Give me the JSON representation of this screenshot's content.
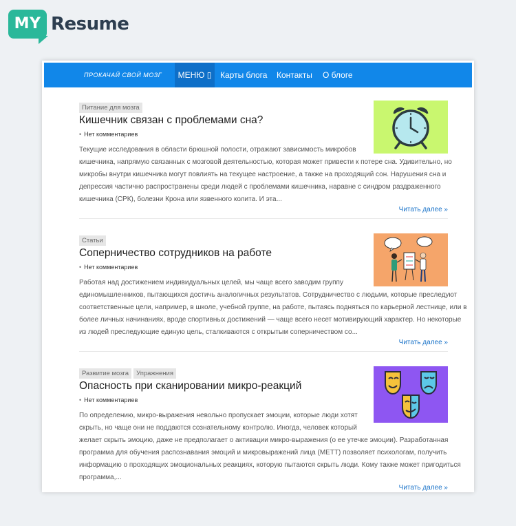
{
  "logo": {
    "badge": "MY",
    "word": "Resume"
  },
  "nav": {
    "brand": "ПРОКАЧАЙ СВОЙ МОЗГ",
    "menu_label": "МЕНЮ ▯",
    "links": [
      "Карты блога",
      "Контакты",
      "О блоге"
    ]
  },
  "posts": [
    {
      "tags": [
        "Питание для мозга"
      ],
      "title": "Кишечник связан с проблемами сна?",
      "comments": "Нет комментариев",
      "excerpt_lines": [
        "Текущие исследования в области брюшной полости, отражают зависимость микробов",
        "кишечника, напрямую связанных с мозговой деятельностью, которая может привести к потере сна. Удивительно, но",
        "микробы внутри кишечника могут повлиять на текущее настроение, а также на проходящий сон. Нарушения сна и",
        "депрессия частично распространены среди людей с проблемами кишечника, наравне с синдром раздраженного",
        "кишечника (СРК), болезни Крона или язвенного колита. И эта..."
      ],
      "more": "Читать далее »",
      "image": "alarm-clock-icon",
      "image_bg": "#c9f76f"
    },
    {
      "tags": [
        "Статьи"
      ],
      "title": "Соперничество сотрудников на работе",
      "comments": "Нет комментариев",
      "excerpt_lines": [
        "Работая над достижением индивидуальных целей, мы чаще всего заводим группу",
        "единомышленников, пытающихся достичь аналогичных результатов. Сотрудничество с людьми, которые преследуют",
        "соответственные цели, например, в школе, учебной группе, на работе, пытаясь подняться по карьерной лестнице, или в",
        "более личных начинаниях, вроде спортивных достижений — чаще всего несет мотивирующий характер. Но некоторые",
        "из людей преследующие единую цель, сталкиваются с открытым соперничеством со..."
      ],
      "more": "Читать далее »",
      "image": "two-people-speech-bubbles-icon",
      "image_bg": "#f5a56a"
    },
    {
      "tags": [
        "Развитие мозга",
        "Упражнения"
      ],
      "title": "Опасность при сканировании микро-реакций",
      "comments": "Нет комментариев",
      "excerpt_lines": [
        "По определению, микро-выражения невольно пропускает эмоции, которые люди хотят",
        "скрыть, но чаще они не поддаются сознательному контролю. Иногда, человек который",
        "желает скрыть эмоцию, даже не предполагает о активации микро-выражения (о ее утечке эмоции). Разработанная",
        "программа для обучения распознавания эмоций и микровыражений лица (METT) позволяет психологам, получить",
        "информацию о проходящих эмоциональных реакциях, которую пытаются скрыть люди. Кому также может пригодиться",
        "программа,..."
      ],
      "more": "Читать далее »",
      "image": "theater-masks-icon",
      "image_bg": "#8e56f2"
    }
  ]
}
